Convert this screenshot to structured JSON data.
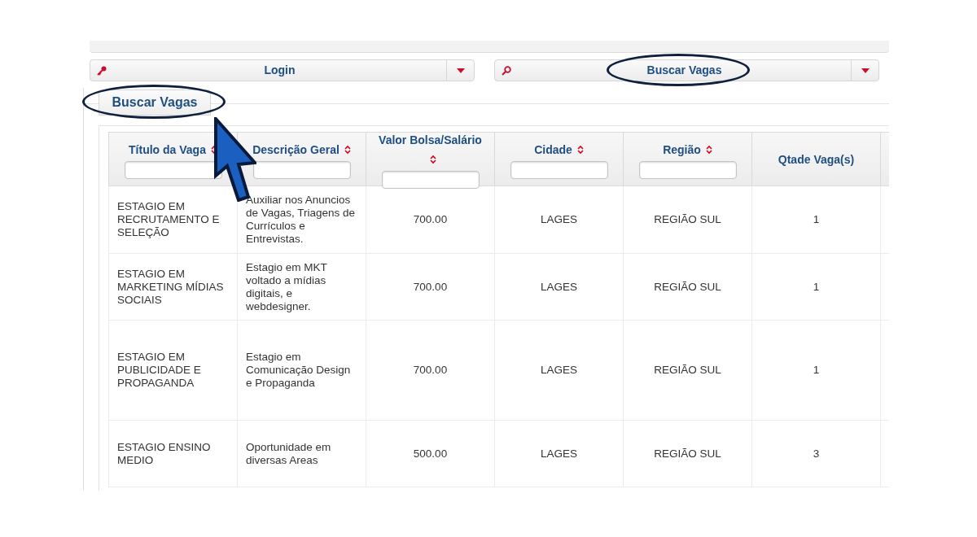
{
  "menus": [
    {
      "label": "Login",
      "kind": "key",
      "circled": false
    },
    {
      "label": "Buscar Vagas",
      "kind": "search",
      "circled": true
    }
  ],
  "tab": {
    "label": "Buscar Vagas",
    "circled": true
  },
  "table": {
    "columns": [
      {
        "label": "Título da Vaga",
        "sortable": true,
        "filter": true
      },
      {
        "label": "Descrição Geral",
        "sortable": true,
        "filter": true
      },
      {
        "label": "Valor Bolsa/Salário",
        "sortable": true,
        "filter": true
      },
      {
        "label": "Cidade",
        "sortable": true,
        "filter": true
      },
      {
        "label": "Região",
        "sortable": true,
        "filter": true
      },
      {
        "label": "Qtade Vaga(s)",
        "sortable": false,
        "filter": false
      }
    ],
    "rows": [
      [
        "ESTAGIO EM RECRUTAMENTO E SELEÇÃO",
        "Auxiliar nos Anuncios de Vagas, Triagens de Currículos e Entrevistas.",
        "700.00",
        "LAGES",
        "REGIÃO SUL",
        "1"
      ],
      [
        "ESTAGIO EM MARKETING MÍDIAS SOCIAIS",
        "Estagio em MKT voltado a mídias digitais, e webdesigner.",
        "700.00",
        "LAGES",
        "REGIÃO SUL",
        "1"
      ],
      [
        "ESTAGIO EM PUBLICIDADE E PROPAGANDA",
        "Estagio em Comunicação Design e Propaganda",
        "700.00",
        "LAGES",
        "REGIÃO SUL",
        "1"
      ],
      [
        "ESTAGIO ENSINO MEDIO",
        "Oportunidade em diversas Areas",
        "500.00",
        "LAGES",
        "REGIÃO SUL",
        "3"
      ]
    ]
  }
}
